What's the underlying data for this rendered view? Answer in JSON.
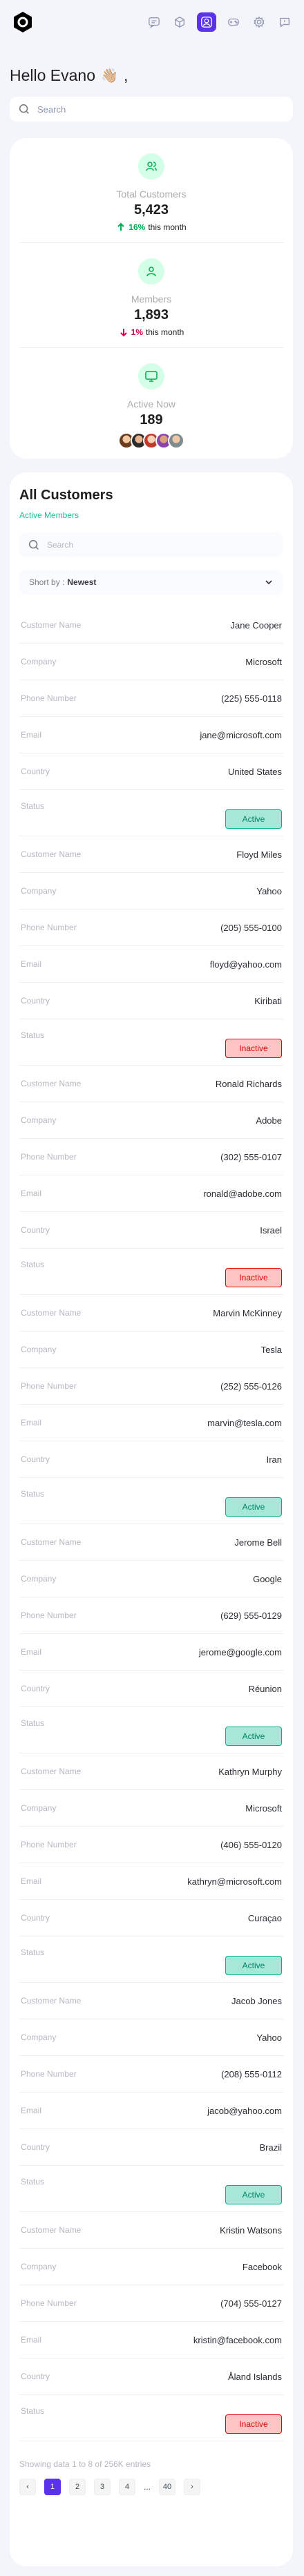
{
  "header": {
    "nav_icons": [
      "chat-icon",
      "box-icon",
      "user-square-icon",
      "gamepad-icon",
      "settings-icon",
      "message-icon"
    ],
    "active_nav_index": 2,
    "accent": "#5932ea"
  },
  "greeting": {
    "text": "Hello Evano",
    "emoji": "👋🏼"
  },
  "search": {
    "placeholder": "Search"
  },
  "stats": [
    {
      "label": "Total Customers",
      "value": "5,423",
      "trend_value": "16%",
      "trend_suffix": " this month",
      "trend_dir": "up"
    },
    {
      "label": "Members",
      "value": "1,893",
      "trend_value": "1%",
      "trend_suffix": " this month",
      "trend_dir": "down"
    },
    {
      "label": "Active Now",
      "value": "189"
    }
  ],
  "customers": {
    "title": "All Customers",
    "subtitle": "Active Members",
    "search_placeholder": "Search",
    "sort_label": "Short by :",
    "sort_value": "Newest",
    "field_labels": {
      "name": "Customer Name",
      "company": "Company",
      "phone": "Phone Number",
      "email": "Email",
      "country": "Country",
      "status": "Status"
    },
    "records": [
      {
        "name": "Jane Cooper",
        "company": "Microsoft",
        "phone": "(225) 555-0118",
        "email": "jane@microsoft.com",
        "country": "United States",
        "status": "Active"
      },
      {
        "name": "Floyd Miles",
        "company": "Yahoo",
        "phone": "(205) 555-0100",
        "email": "floyd@yahoo.com",
        "country": "Kiribati",
        "status": "Inactive"
      },
      {
        "name": "Ronald Richards",
        "company": "Adobe",
        "phone": "(302) 555-0107",
        "email": "ronald@adobe.com",
        "country": "Israel",
        "status": "Inactive"
      },
      {
        "name": "Marvin McKinney",
        "company": "Tesla",
        "phone": "(252) 555-0126",
        "email": "marvin@tesla.com",
        "country": "Iran",
        "status": "Active"
      },
      {
        "name": "Jerome Bell",
        "company": "Google",
        "phone": "(629) 555-0129",
        "email": "jerome@google.com",
        "country": "Réunion",
        "status": "Active"
      },
      {
        "name": "Kathryn Murphy",
        "company": "Microsoft",
        "phone": "(406) 555-0120",
        "email": "kathryn@microsoft.com",
        "country": "Curaçao",
        "status": "Active"
      },
      {
        "name": "Jacob Jones",
        "company": "Yahoo",
        "phone": "(208) 555-0112",
        "email": "jacob@yahoo.com",
        "country": "Brazil",
        "status": "Active"
      },
      {
        "name": "Kristin Watsons",
        "company": "Facebook",
        "phone": "(704) 555-0127",
        "email": "kristin@facebook.com",
        "country": "Åland Islands",
        "status": "Inactive"
      }
    ],
    "footer": "Showing data 1 to 8 of 256K entries",
    "pagination": {
      "prev": "‹",
      "pages": [
        "1",
        "2",
        "3",
        "4"
      ],
      "dots": "...",
      "last": "40",
      "next": "›",
      "current": "1"
    }
  }
}
